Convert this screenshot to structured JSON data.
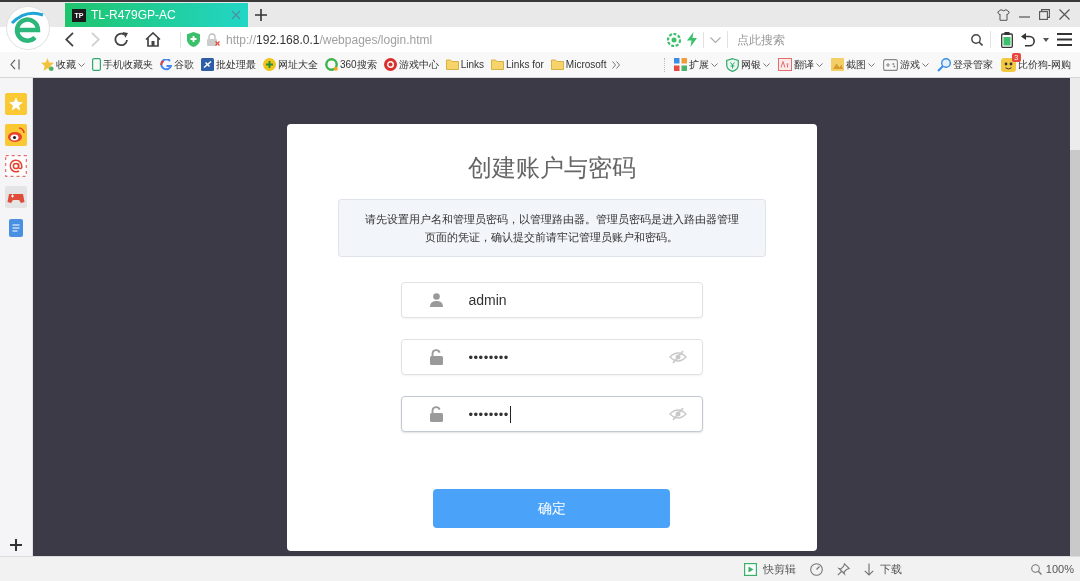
{
  "tabs": [
    {
      "favicon_text": "TP",
      "title": "TL-R479GP-AC",
      "selected": true
    }
  ],
  "navigation": {
    "back_disabled": false,
    "forward_disabled": true
  },
  "address_bar": {
    "scheme": "http://",
    "host": "192.168.0.1",
    "path": "/webpages/login.html"
  },
  "search": {
    "placeholder": "点此搜索"
  },
  "bookmarks": [
    {
      "kind": "star",
      "label": "收藏",
      "dropdown": true
    },
    {
      "kind": "phone",
      "label": "手机收藏夹",
      "dropdown": false
    },
    {
      "kind": "g",
      "label": "谷歌",
      "dropdown": false
    },
    {
      "kind": "tile",
      "label": "批处理最",
      "dropdown": false
    },
    {
      "kind": "plus",
      "label": "网址大全",
      "dropdown": false
    },
    {
      "kind": "ring",
      "label": "360搜索",
      "dropdown": false
    },
    {
      "kind": "disc",
      "label": "游戏中心",
      "dropdown": false
    },
    {
      "kind": "folder",
      "label": "Links",
      "dropdown": false
    },
    {
      "kind": "folder",
      "label": "Links for",
      "dropdown": false
    },
    {
      "kind": "folder",
      "label": "Microsoft",
      "dropdown": false
    }
  ],
  "extensions": [
    {
      "kind": "grid",
      "label": "扩展",
      "dropdown": true
    },
    {
      "kind": "shield",
      "label": "网银",
      "dropdown": true
    },
    {
      "kind": "translate",
      "label": "翻译",
      "dropdown": true
    },
    {
      "kind": "image",
      "label": "截图",
      "dropdown": true
    },
    {
      "kind": "gamepad",
      "label": "游戏",
      "dropdown": true
    },
    {
      "kind": "key",
      "label": "登录管家",
      "dropdown": false
    },
    {
      "kind": "dog",
      "label": "比价狗-网购",
      "dropdown": false,
      "badge": "3"
    }
  ],
  "sidebar": {
    "items": [
      {
        "kind": "star"
      },
      {
        "kind": "eye"
      },
      {
        "kind": "at"
      },
      {
        "kind": "gamepad"
      },
      {
        "kind": "document"
      }
    ]
  },
  "dialog": {
    "title": "创建账户与密码",
    "notice": "请先设置用户名和管理员密码，以管理路由器。管理员密码是进入路由器管理页面的凭证，确认提交前请牢记管理员账户和密码。",
    "fields": [
      {
        "kind": "username",
        "value": "admin",
        "focused": false
      },
      {
        "kind": "password",
        "value": "••••••••",
        "focused": false
      },
      {
        "kind": "password",
        "value": "••••••••",
        "focused": true
      }
    ],
    "submit": "确定"
  },
  "status_bar": {
    "items": [
      {
        "kind": "play",
        "label": "快剪辑"
      },
      {
        "kind": "gauge"
      },
      {
        "kind": "pin"
      },
      {
        "kind": "download",
        "label": "下载"
      },
      {
        "kind": "zoom",
        "label": "100%"
      }
    ]
  }
}
